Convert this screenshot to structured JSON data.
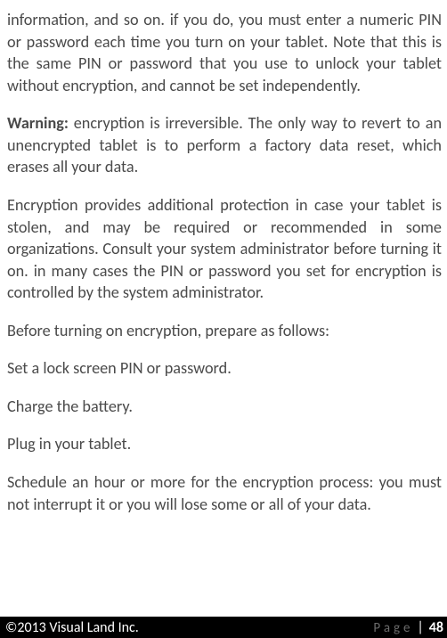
{
  "paragraphs": {
    "p1": "information, and so on. if you do, you must enter a numeric PIN or password each time you turn on your tablet. Note that this is the same PIN or password that you use to unlock your tablet without encryption, and cannot be set independently.",
    "warning_label": "Warning:",
    "warning_text": " encryption is irreversible. The only way to revert to an unencrypted tablet is to perform a factory data reset, which erases all your data.",
    "p3": "Encryption provides additional protection in case your tablet is stolen, and may be required or recommended in some organizations. Consult your system administrator before turning it on. in many cases the PIN or password you set for encryption is controlled by the system administrator.",
    "p4": "Before turning on encryption, prepare as follows:",
    "p5": "Set a lock screen PIN or password.",
    "p6": "Charge the battery.",
    "p7": "Plug in your tablet.",
    "p8": "Schedule an hour or more for the encryption process: you must not interrupt it or you will lose some or all of your data."
  },
  "footer": {
    "copyright": "©2013 Visual Land Inc.",
    "page_label": "Page",
    "page_separator": "|",
    "page_number": "48"
  }
}
